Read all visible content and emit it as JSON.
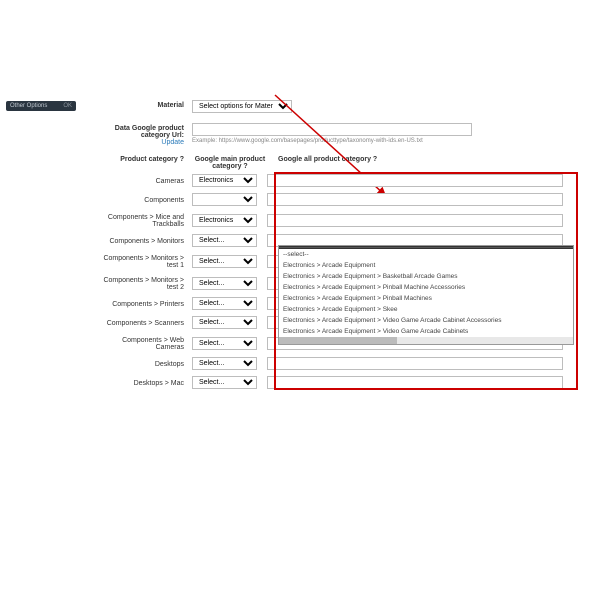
{
  "side_badge": {
    "text": "Other Options",
    "close": "OK"
  },
  "material": {
    "label": "Material",
    "select_value": "Select options for Materi"
  },
  "data_url": {
    "label1": "Data Google product",
    "label2": "category Url:",
    "update": "Update",
    "hint": "Example: https://www.google.com/basepages/producttype/taxonomy-with-ids.en-US.txt",
    "value": ""
  },
  "headers": {
    "col1": "Product category",
    "col2": "Google main product category",
    "col3": "Google all product category"
  },
  "rows": [
    {
      "name": "Cameras",
      "sel": "Electronics"
    },
    {
      "name": "Components",
      "sel": ""
    },
    {
      "name": "Components > Mice and Trackballs",
      "sel": "Electronics"
    },
    {
      "name": "Components > Monitors",
      "sel": "Select..."
    },
    {
      "name": "Components > Monitors > test 1",
      "sel": "Select..."
    },
    {
      "name": "Components > Monitors > test 2",
      "sel": "Select..."
    },
    {
      "name": "Components > Printers",
      "sel": "Select..."
    },
    {
      "name": "Components > Scanners",
      "sel": "Select..."
    },
    {
      "name": "Components > Web Cameras",
      "sel": "Select..."
    },
    {
      "name": "Desktops",
      "sel": "Select..."
    },
    {
      "name": "Desktops > Mac",
      "sel": "Select..."
    }
  ],
  "dropdown": {
    "select": "--select--",
    "opts": [
      "Electronics > Arcade Equipment",
      "Electronics > Arcade Equipment > Basketball Arcade Games",
      "Electronics > Arcade Equipment > Pinball Machine Accessories",
      "Electronics > Arcade Equipment > Pinball Machines",
      "Electronics > Arcade Equipment > Skee",
      "Electronics > Arcade Equipment > Video Game Arcade Cabinet Accessories",
      "Electronics > Arcade Equipment > Video Game Arcade Cabinets"
    ]
  }
}
